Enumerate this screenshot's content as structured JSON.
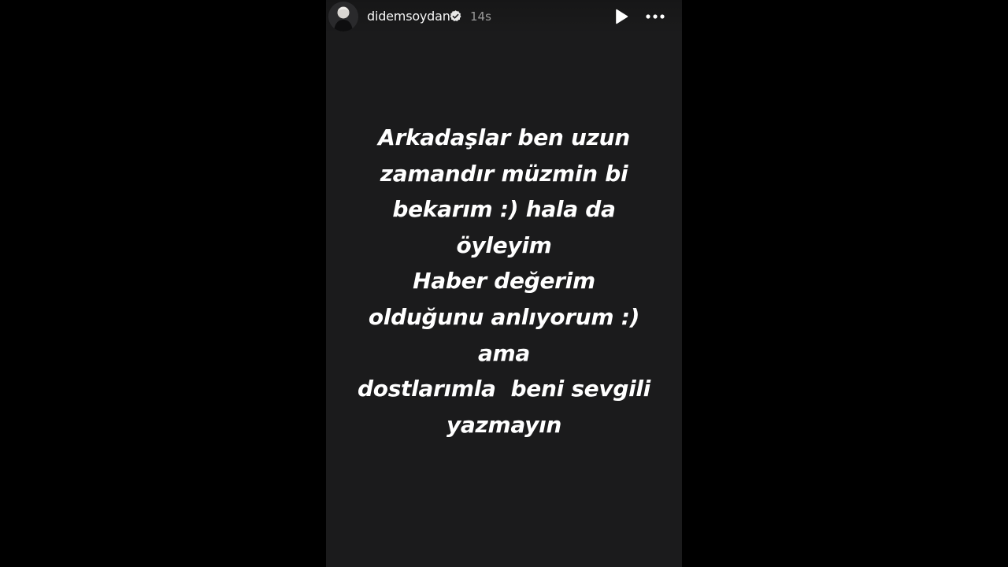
{
  "story": {
    "username": "didemsoydan",
    "timestamp": "14s",
    "verified": true,
    "avatar_icon": "profile-avatar",
    "controls": {
      "play_icon": "play-icon",
      "more_icon": "more-options-icon"
    },
    "text_lines": [
      "Arkadaşlar ben uzun",
      "zamandır müzmin bi",
      "bekarım :) hala da",
      "öyleyim",
      "Haber değerim",
      "olduğunu anlıyorum :)",
      "ama",
      "dostlarımla  beni sevgili",
      "yazmayın"
    ]
  },
  "colors": {
    "page_background": "#000000",
    "story_background": "#1b1b1c",
    "text": "#ffffff",
    "verified_badge": "#e8e8e8",
    "timestamp": "#9a9a9a"
  }
}
